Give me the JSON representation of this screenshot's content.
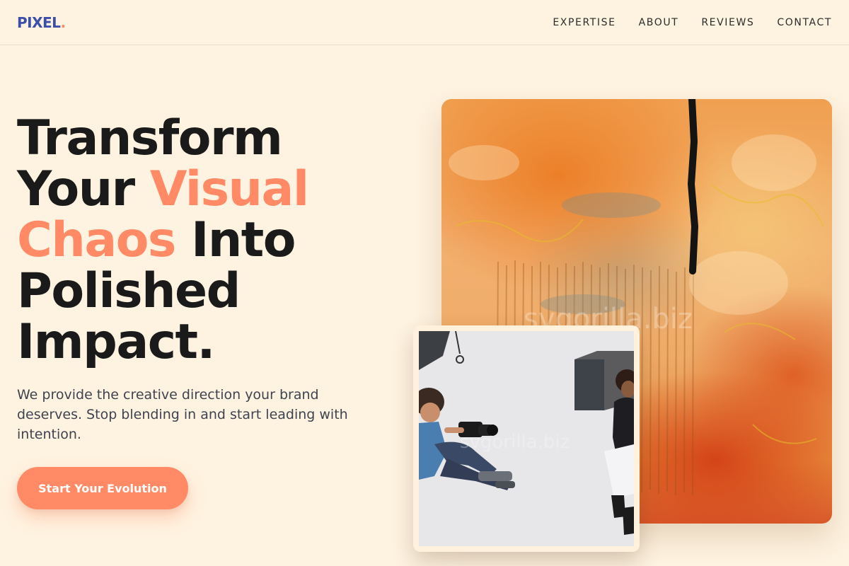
{
  "nav": {
    "logo_text": "PIXEL",
    "logo_dot": ".",
    "links": [
      "EXPERTISE",
      "ABOUT",
      "REVIEWS",
      "CONTACT"
    ]
  },
  "hero": {
    "title_line1": "Transform",
    "title_your": "Your ",
    "title_visual": "Visual",
    "title_chaos": "Chaos",
    "title_into": " Into",
    "title_polished": "Polished",
    "title_impact": "Impact.",
    "subtitle": "We provide the creative direction your brand deserves. Stop blending in and start leading with intention.",
    "cta_label": "Start Your Evolution"
  },
  "images": {
    "painting_watermark": "svgorilla.biz",
    "photo_watermark": "svgorilla.biz"
  },
  "colors": {
    "background": "#fef3e0",
    "accent": "#ff8a65",
    "logo": "#3b4fa8",
    "text": "#1a1a1a"
  }
}
